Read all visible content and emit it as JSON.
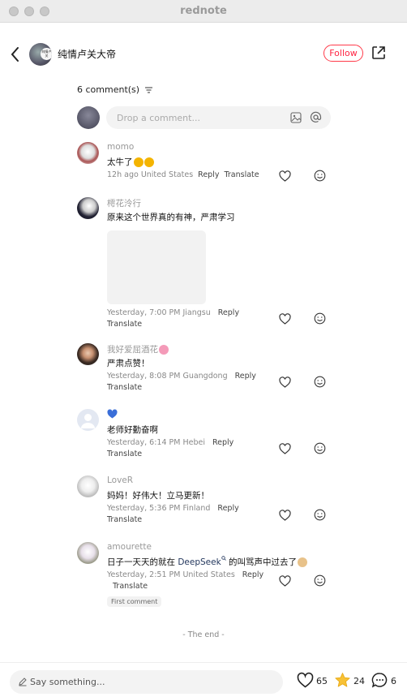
{
  "app": {
    "title": "rednote"
  },
  "header": {
    "author_name": "纯情卢关大帝",
    "author_badge": "纯情卢关",
    "follow_label": "Follow"
  },
  "comments_section": {
    "count_label": "6 comment(s)",
    "input_placeholder": "Drop a comment...",
    "end_label": "- The end -"
  },
  "comments": [
    {
      "username": "momo",
      "text": "太牛了",
      "emoji_count": 2,
      "meta": "12h ago United States",
      "reply": "Reply",
      "translate": "Translate"
    },
    {
      "username": "樗花泠行",
      "text": "原来这个世界真的有神，严肃学习",
      "meta": "Yesterday, 7:00 PM Jiangsu",
      "reply": "Reply",
      "translate": "Translate"
    },
    {
      "username": "我好爱屈酒花",
      "text": "严肃点赞！",
      "meta": "Yesterday, 8:08 PM Guangdong",
      "reply": "Reply",
      "translate": "Translate"
    },
    {
      "username": "",
      "text": "老师好勤奋啊",
      "meta": "Yesterday, 6:14 PM Hebei",
      "reply": "Reply",
      "translate": "Translate"
    },
    {
      "username": "LoveR",
      "text": "妈妈！好伟大！立马更新！",
      "meta": "Yesterday, 5:36 PM Finland",
      "reply": "Reply",
      "translate": "Translate"
    },
    {
      "username": "amourette",
      "text_prefix": "日子一天天的就在 ",
      "text_link": "DeepSeek",
      "text_suffix": " 的叫骂声中过去了",
      "meta": "Yesterday, 2:51 PM United States",
      "reply": "Reply",
      "translate": "Translate",
      "tag": "First comment"
    }
  ],
  "footer": {
    "say_placeholder": "Say something...",
    "likes": "65",
    "stars": "24",
    "comments": "6"
  },
  "colors": {
    "accent": "#ff2442",
    "link": "#23375d",
    "muted": "#888888"
  }
}
